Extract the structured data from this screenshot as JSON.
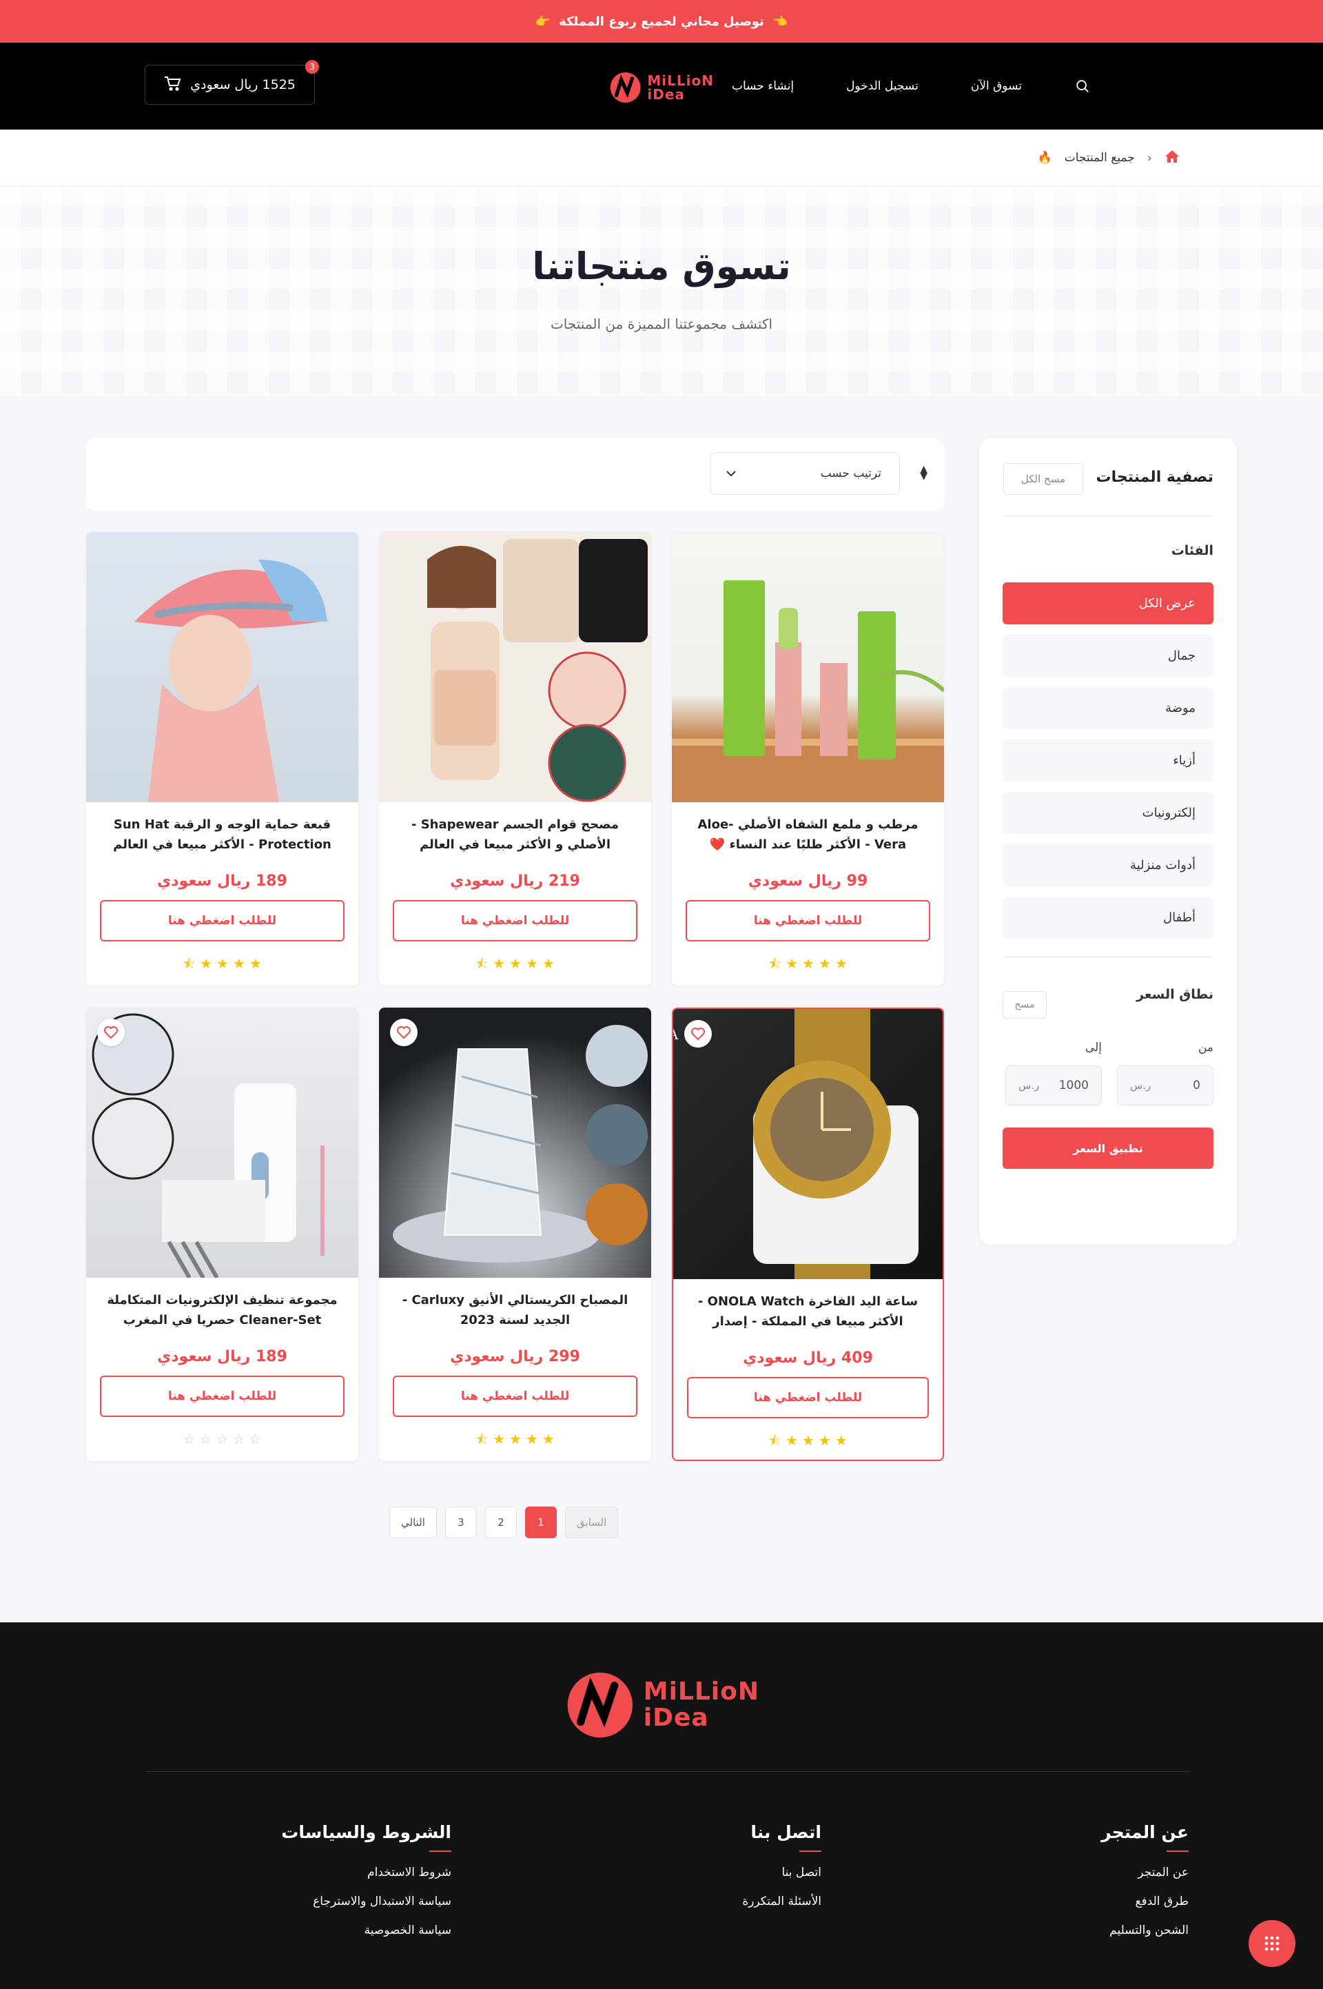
{
  "announcement": {
    "text": "توصيل مجاني لجميع ربوع المملكة",
    "emoji_left": "👈",
    "emoji_right": "👉"
  },
  "header": {
    "nav": [
      "تسوق الآن",
      "تسجيل الدخول",
      "إنشاء حساب"
    ],
    "logo_line1": "MiLLioN",
    "logo_line2": "iDea",
    "cart_total": "1525 ريال سعودي",
    "cart_count": "3"
  },
  "breadcrumb": {
    "current": "جميع المنتجات"
  },
  "hero": {
    "title": "تسوق منتجاتنا",
    "subtitle": "اكتشف مجموعتنا المميزة من المنتجات"
  },
  "sidebar": {
    "title": "تصفية المنتجات",
    "clear_all": "مسح الكل",
    "categories_title": "الفئات",
    "categories": [
      "عرض الكل",
      "جمال",
      "موضة",
      "أزياء",
      "إلكترونيات",
      "أدوات منزلية",
      "أطفال"
    ],
    "price_title": "نطاق السعر",
    "price_clear": "مسح",
    "from_label": "من",
    "to_label": "إلى",
    "from_value": "0",
    "to_value": "1000",
    "currency": "ر.س",
    "apply": "تطبيق السعر"
  },
  "toolbar": {
    "sort_label": "ترتيب حسب"
  },
  "products": [
    {
      "name": "مرطب و ملمع الشفاه الأصلي Aloe-Vera - الأكثر طلبًا عند النساء ❤️",
      "price": "99 ريال سعودي",
      "button": "للطلب اضغطي هنا",
      "rating": 4.5
    },
    {
      "name": "مصحح قوام الجسم Shapewear - الأصلي و الأكثر مبيعا في العالم",
      "price": "219 ريال سعودي",
      "button": "للطلب اضغطي هنا",
      "rating": 4.5
    },
    {
      "name": "قبعة حماية الوجه و الرقبة Sun Hat Protection - الأكثر مبيعا في العالم",
      "price": "189 ريال سعودي",
      "button": "للطلب اضغطي هنا",
      "rating": 4.5
    },
    {
      "name": "ساعة اليد الفاخرة ONOLA Watch - الأكثر مبيعا في المملكة - إصدار محدود",
      "price": "409 ريال سعودي",
      "button": "للطلب اضغطي هنا",
      "rating": 4.5
    },
    {
      "name": "المصباح الكريستالي الأنيق Carluxy - الجديد لسنة 2023",
      "price": "299 ريال سعودي",
      "button": "للطلب اضغطي هنا",
      "rating": 4.5
    },
    {
      "name": "مجموعة تنظيف الإلكترونيات المتكاملة Cleaner-Set حصريا في المغرب",
      "price": "189 ريال سعودي",
      "button": "للطلب اضغطي هنا",
      "rating": 0
    }
  ],
  "pagination": {
    "prev": "السابق",
    "pages": [
      "1",
      "2",
      "3"
    ],
    "next": "التالي",
    "current": "1"
  },
  "footer": {
    "logo_line1": "MiLLioN",
    "logo_line2": "iDea",
    "columns": [
      {
        "title": "عن المتجر",
        "links": [
          "عن المتجر",
          "طرق الدفع",
          "الشحن والتسليم"
        ]
      },
      {
        "title": "اتصل بنا",
        "links": [
          "اتصل بنا",
          "الأسئلة المتكررة"
        ]
      },
      {
        "title": "الشروط والسياسات",
        "links": [
          "شروط الاستخدام",
          "سياسة الاستبدال والاسترجاع",
          "سياسة الخصوصية"
        ]
      }
    ]
  },
  "colors": {
    "accent": "#f04b4f",
    "dark": "#000000",
    "footer_bg": "#141314"
  }
}
